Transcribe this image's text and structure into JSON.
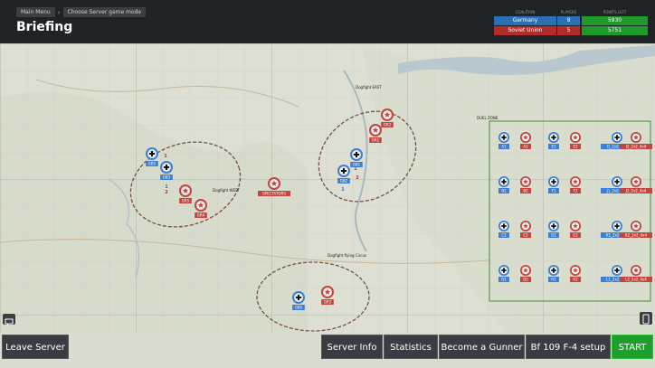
{
  "header": {
    "breadcrumbs": [
      "Main Menu",
      "Choose Server game mode"
    ],
    "title": "Briefing"
  },
  "scoreboard": {
    "headers": {
      "nation": "COALITION",
      "players": "PLAYERS",
      "points": "POINTS LEFT"
    },
    "teams": [
      {
        "nation": "Germany",
        "players": "8",
        "points": "5930",
        "color": "#2b6fb5"
      },
      {
        "nation": "Soviet Union",
        "players": "5",
        "points": "5751",
        "color": "#b32b2b"
      }
    ]
  },
  "map": {
    "zones": [
      {
        "label": "Dogfight EAST"
      },
      {
        "label": "Dogfight WEST"
      },
      {
        "label": "Dogfight flying Circus"
      },
      {
        "label": "DUEL ZONE"
      }
    ],
    "spectators_label": "SPECTATORS",
    "west_units": [
      {
        "side": "german",
        "label": "GB5"
      },
      {
        "side": "german",
        "label": "GB3"
      },
      {
        "side": "soviet",
        "label": "GR5"
      },
      {
        "side": "soviet",
        "label": "GR4"
      }
    ],
    "west_ids": [
      "1",
      "1",
      "2"
    ],
    "east_units": [
      {
        "side": "soviet",
        "label": "GR2"
      },
      {
        "side": "soviet",
        "label": "GR1"
      },
      {
        "side": "german",
        "label": "GB1"
      },
      {
        "side": "german",
        "label": "GB2"
      }
    ],
    "east_ids": [
      "1",
      "2",
      "1"
    ],
    "circus_units": [
      {
        "side": "german",
        "label": "GB5"
      },
      {
        "side": "soviet",
        "label": "GR3"
      }
    ],
    "duel_rows": [
      [
        "A1",
        "A2",
        "E1",
        "E2",
        "I1_2x2_4x4",
        "I2_2x2_4x4"
      ],
      [
        "B1",
        "B2",
        "F1",
        "F2",
        "J1_2x2_4x4",
        "J2_2x2_4x4"
      ],
      [
        "C1",
        "C2",
        "G1",
        "G2",
        "K1_2x2_4x4",
        "K2_2x2_4x4"
      ],
      [
        "D1",
        "D2",
        "H1",
        "H2",
        "L1_2x2_4x4",
        "L2_2x2_4x4"
      ]
    ]
  },
  "buttons": {
    "leave": "Leave Server",
    "server_info": "Server Info",
    "statistics": "Statistics",
    "gunner": "Become a Gunner",
    "setup": "Bf 109 F-4 setup",
    "start": "START"
  },
  "icons": {
    "chat": "chat-icon",
    "device": "device-icon"
  }
}
